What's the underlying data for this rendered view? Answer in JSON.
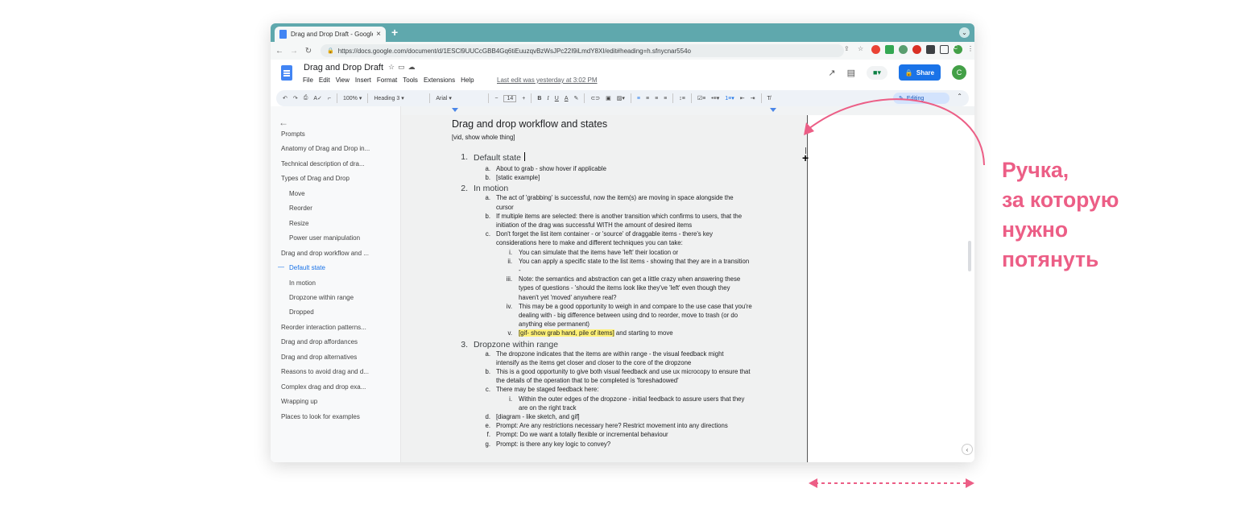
{
  "browser": {
    "tab_title": "Drag and Drop Draft - Google D",
    "tab_close": "×",
    "new_tab": "+",
    "tab_menu": "⌄",
    "url": "https://docs.google.com/document/d/1ESCl9UUCcGBB4Gq6tiEuuzqvBzWsJPc22I9iLmdY8XI/edit#heading=h.sfnycnar554o",
    "avatar_letter": "C"
  },
  "doc_header": {
    "title": "Drag and Drop Draft",
    "menus": [
      "File",
      "Edit",
      "View",
      "Insert",
      "Format",
      "Tools",
      "Extensions",
      "Help"
    ],
    "last_edit": "Last edit was yesterday at 3:02 PM",
    "share_label": "Share",
    "avatar_letter": "C"
  },
  "toolbar": {
    "zoom": "100%",
    "style": "Heading 3",
    "font": "Arial",
    "font_size": "14",
    "mode": "Editing"
  },
  "outline": {
    "items": [
      {
        "label": "Prompts",
        "level": 0,
        "active": false
      },
      {
        "label": "Anatomy of Drag and Drop in...",
        "level": 0,
        "active": false
      },
      {
        "label": "Technical description of dra...",
        "level": 0,
        "active": false
      },
      {
        "label": "Types of Drag and Drop",
        "level": 0,
        "active": false
      },
      {
        "label": "Move",
        "level": 1,
        "active": false
      },
      {
        "label": "Reorder",
        "level": 1,
        "active": false
      },
      {
        "label": "Resize",
        "level": 1,
        "active": false
      },
      {
        "label": "Power user manipulation",
        "level": 1,
        "active": false
      },
      {
        "label": "Drag and drop workflow and ...",
        "level": 0,
        "active": false
      },
      {
        "label": "Default state",
        "level": 1,
        "active": true
      },
      {
        "label": "In motion",
        "level": 1,
        "active": false
      },
      {
        "label": "Dropzone within range",
        "level": 1,
        "active": false
      },
      {
        "label": "Dropped",
        "level": 1,
        "active": false
      },
      {
        "label": "Reorder interaction patterns...",
        "level": 0,
        "active": false
      },
      {
        "label": "Drag and drop affordances",
        "level": 0,
        "active": false
      },
      {
        "label": "Drag and drop alternatives",
        "level": 0,
        "active": false
      },
      {
        "label": "Reasons to avoid drag and d...",
        "level": 0,
        "active": false
      },
      {
        "label": "Complex drag and drop exa...",
        "level": 0,
        "active": false
      },
      {
        "label": "Wrapping up",
        "level": 0,
        "active": false
      },
      {
        "label": "Places to look for examples",
        "level": 0,
        "active": false
      }
    ]
  },
  "document": {
    "lines": [
      {
        "kind": "h1",
        "text": "Drag and drop workflow and states"
      },
      {
        "kind": "note",
        "text": "[vid, show whole thing]"
      },
      {
        "kind": "h2",
        "marker": "1.",
        "text": "Default state",
        "cursor": true
      },
      {
        "kind": "txt",
        "marker": "a.",
        "text": "About to grab - show hover if applicable"
      },
      {
        "kind": "txt",
        "marker": "b.",
        "text": "[static example]"
      },
      {
        "kind": "h2",
        "marker": "2.",
        "text": "In motion"
      },
      {
        "kind": "txt",
        "marker": "a.",
        "text": "The act of 'grabbing' is successful, now the item(s) are moving in space alongside the"
      },
      {
        "kind": "txt",
        "text": "cursor"
      },
      {
        "kind": "txt",
        "marker": "b.",
        "text": "If multiple items are selected: there is another transition which confirms to users, that the"
      },
      {
        "kind": "txt",
        "text": "initiation of the drag was successful WITH the amount of desired items"
      },
      {
        "kind": "txt",
        "marker": "c.",
        "text": "Don't forget the list item container - or 'source' of draggable items - there's key"
      },
      {
        "kind": "txt",
        "text": "considerations here to make and different techniques you can take:"
      },
      {
        "kind": "txt",
        "marker": "i.",
        "text": "You can simulate that the items have 'left' their location or"
      },
      {
        "kind": "txt",
        "marker": "ii.",
        "text": "You can apply a specific state to the list items - showing that they are in a transition"
      },
      {
        "kind": "txt",
        "text": "-"
      },
      {
        "kind": "txt",
        "marker": "iii.",
        "text": "Note: the semantics and abstraction can get a little crazy when answering these"
      },
      {
        "kind": "txt",
        "text": "types of questions - 'should the items look like they've 'left' even though they"
      },
      {
        "kind": "txt",
        "text": "haven't yet 'moved' anywhere real?"
      },
      {
        "kind": "txt",
        "marker": "iv.",
        "text": "This may be a good opportunity to weigh in and compare to the use case that you're"
      },
      {
        "kind": "txt",
        "text": "dealing with - big difference between using dnd to reorder, move to trash (or do"
      },
      {
        "kind": "txt",
        "text": "anything else permanent)"
      },
      {
        "kind": "txt",
        "marker": "v.",
        "highlight": "[gif- show grab hand, pile of items]",
        "text": " and starting to move"
      },
      {
        "kind": "h2",
        "marker": "3.",
        "text": "Dropzone within range"
      },
      {
        "kind": "txt",
        "marker": "a.",
        "text": "The dropzone indicates that the items are within range - the visual feedback might"
      },
      {
        "kind": "txt",
        "text": "intensify as the items get closer and closer to the core of the dropzone"
      },
      {
        "kind": "txt",
        "marker": "b.",
        "text": "This is a good opportunity to give both visual feedback and use ux microcopy to ensure that"
      },
      {
        "kind": "txt",
        "text": "the details of the operation that to be completed is 'foreshadowed'"
      },
      {
        "kind": "txt",
        "marker": "c.",
        "text": "There may be staged feedback here:"
      },
      {
        "kind": "txt",
        "marker": "i.",
        "text": "Within the outer edges of the dropzone - initial feedback to assure users that they"
      },
      {
        "kind": "txt",
        "text": "are on the right track"
      },
      {
        "kind": "txt",
        "marker": "d.",
        "text": "[diagram - like sketch, and gif]"
      },
      {
        "kind": "txt",
        "marker": "e.",
        "text": "Prompt: Are any restrictions necessary here? Restrict movement into any directions"
      },
      {
        "kind": "txt",
        "marker": "f.",
        "text": "Prompt: Do we want a totally flexible or incremental behaviour"
      },
      {
        "kind": "txt",
        "marker": "g.",
        "text": "Prompt: is there any key logic to convey?"
      }
    ]
  },
  "annotation": {
    "lines": [
      "Ручка,",
      "за которую",
      "нужно",
      "потянуть"
    ],
    "color": "#ec5e86"
  }
}
